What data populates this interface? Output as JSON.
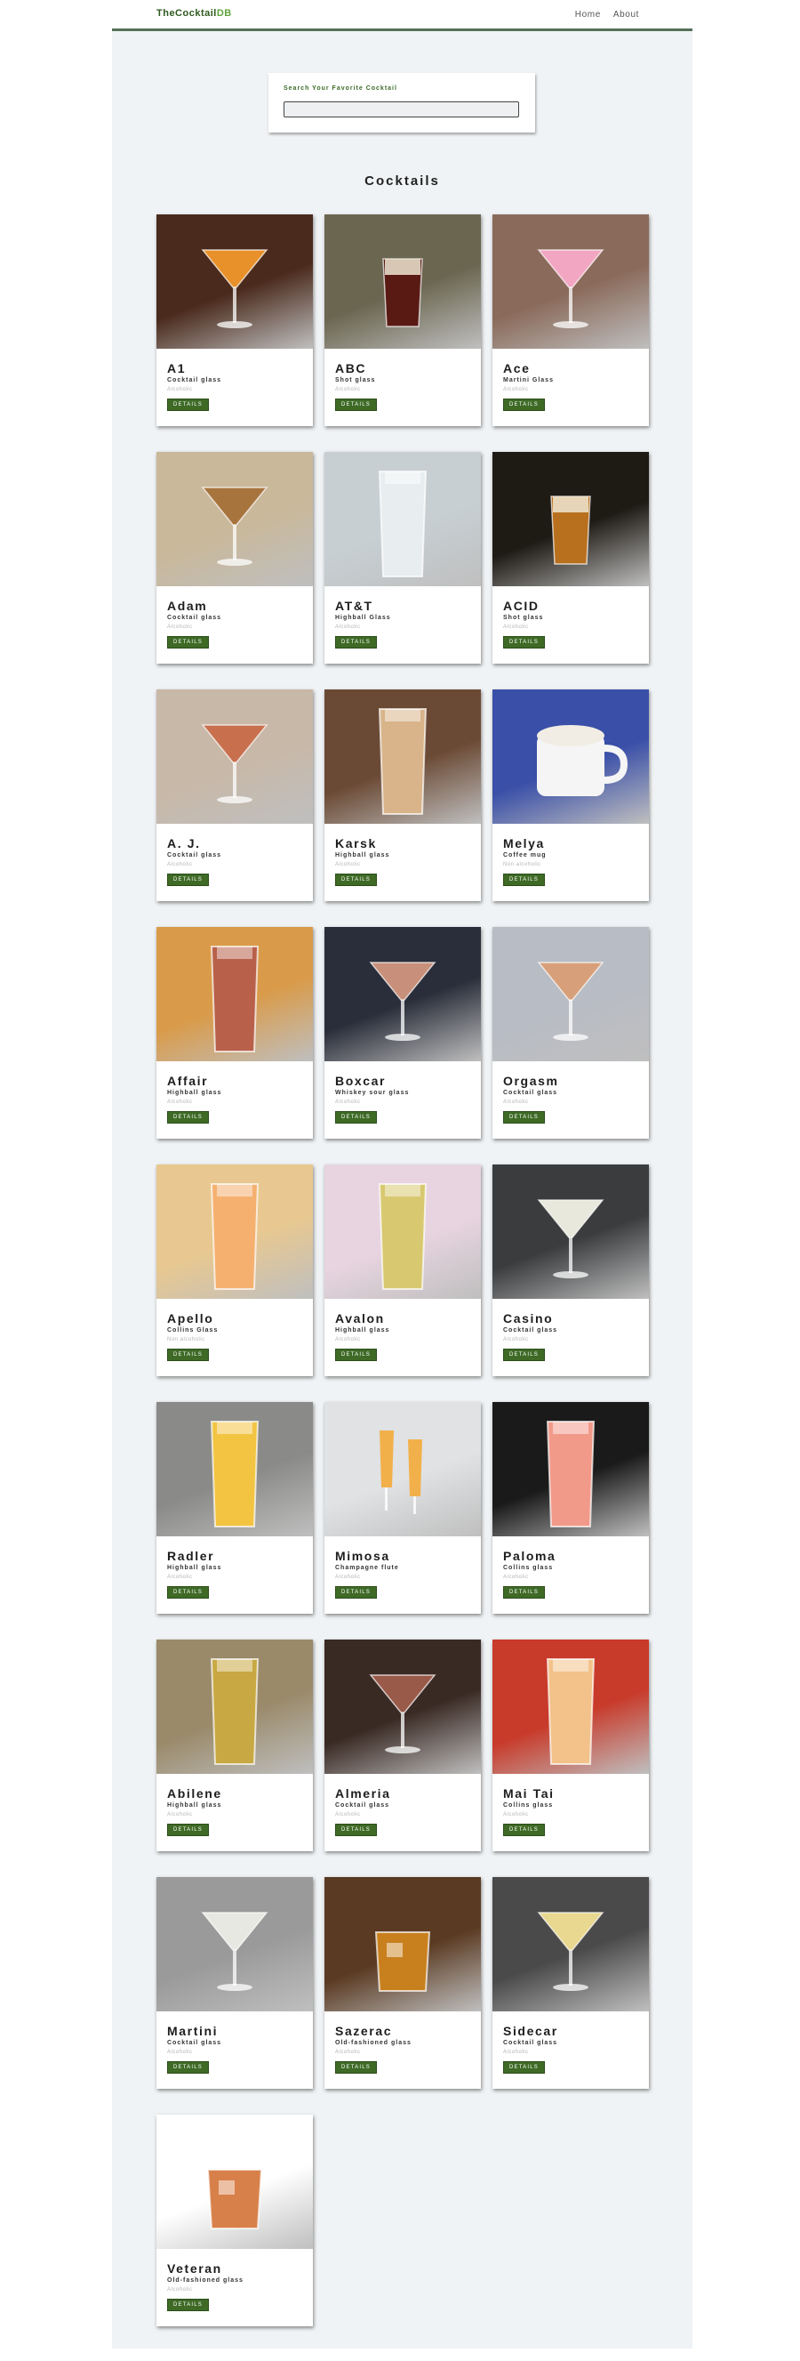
{
  "brand": {
    "part1": "TheCocktail",
    "part2": "DB"
  },
  "nav": {
    "home": "Home",
    "about": "About"
  },
  "search": {
    "label": "Search Your Favorite Cocktail",
    "value": "",
    "placeholder": ""
  },
  "section_title": "Cocktails",
  "details_label": "DETAILS",
  "cocktails": [
    {
      "name": "A1",
      "glass": "Cocktail glass",
      "alcoholic": "Alcoholic",
      "bg": "#4a2a1c",
      "drink": "#e8902a"
    },
    {
      "name": "ABC",
      "glass": "Shot glass",
      "alcoholic": "Alcoholic",
      "bg": "#6b6650",
      "drink": "#5a1a14"
    },
    {
      "name": "Ace",
      "glass": "Martini Glass",
      "alcoholic": "Alcoholic",
      "bg": "#8a6a5a",
      "drink": "#f2a6c2"
    },
    {
      "name": "Adam",
      "glass": "Cocktail glass",
      "alcoholic": "Alcoholic",
      "bg": "#c9b89a",
      "drink": "#a8743e"
    },
    {
      "name": "AT&T",
      "glass": "Highball Glass",
      "alcoholic": "Alcoholic",
      "bg": "#c7cfd3",
      "drink": "#e8eef0"
    },
    {
      "name": "ACID",
      "glass": "Shot glass",
      "alcoholic": "Alcoholic",
      "bg": "#1e1a14",
      "drink": "#b8701f"
    },
    {
      "name": "A. J.",
      "glass": "Cocktail glass",
      "alcoholic": "Alcoholic",
      "bg": "#c8b8a8",
      "drink": "#c8704e"
    },
    {
      "name": "Karsk",
      "glass": "Highball glass",
      "alcoholic": "Alcoholic",
      "bg": "#6b4a35",
      "drink": "#d9b48a"
    },
    {
      "name": "Melya",
      "glass": "Coffee mug",
      "alcoholic": "Non alcoholic",
      "bg": "#3a4fa8",
      "drink": "#f2ede4"
    },
    {
      "name": "Affair",
      "glass": "Highball glass",
      "alcoholic": "Alcoholic",
      "bg": "#d99b4a",
      "drink": "#b8604a"
    },
    {
      "name": "Boxcar",
      "glass": "Whiskey sour glass",
      "alcoholic": "Alcoholic",
      "bg": "#2a2e3a",
      "drink": "#c8907a"
    },
    {
      "name": "Orgasm",
      "glass": "Cocktail glass",
      "alcoholic": "Alcoholic",
      "bg": "#b8bcc4",
      "drink": "#d8a07a"
    },
    {
      "name": "Apello",
      "glass": "Collins Glass",
      "alcoholic": "Non alcoholic",
      "bg": "#e8c890",
      "drink": "#f5b070"
    },
    {
      "name": "Avalon",
      "glass": "Highball glass",
      "alcoholic": "Alcoholic",
      "bg": "#e8d4e0",
      "drink": "#d8c870"
    },
    {
      "name": "Casino",
      "glass": "Cocktail glass",
      "alcoholic": "Alcoholic",
      "bg": "#3a3c3e",
      "drink": "#e8e8dc"
    },
    {
      "name": "Radler",
      "glass": "Highball glass",
      "alcoholic": "Alcoholic",
      "bg": "#8a8a88",
      "drink": "#f2c442"
    },
    {
      "name": "Mimosa",
      "glass": "Champagne flute",
      "alcoholic": "Alcoholic",
      "bg": "#e0e2e4",
      "drink": "#f2b04a"
    },
    {
      "name": "Paloma",
      "glass": "Collins glass",
      "alcoholic": "Alcoholic",
      "bg": "#1a1a1a",
      "drink": "#f29a8a"
    },
    {
      "name": "Abilene",
      "glass": "Highball glass",
      "alcoholic": "Alcoholic",
      "bg": "#9a8a6a",
      "drink": "#c8a842"
    },
    {
      "name": "Almeria",
      "glass": "Cocktail glass",
      "alcoholic": "Alcoholic",
      "bg": "#3a2a24",
      "drink": "#9a5a4a"
    },
    {
      "name": "Mai Tai",
      "glass": "Collins glass",
      "alcoholic": "Alcoholic",
      "bg": "#c83a2a",
      "drink": "#f2c28a"
    },
    {
      "name": "Martini",
      "glass": "Cocktail glass",
      "alcoholic": "Alcoholic",
      "bg": "#9a9a9a",
      "drink": "#e8e8e2"
    },
    {
      "name": "Sazerac",
      "glass": "Old-fashioned glass",
      "alcoholic": "Alcoholic",
      "bg": "#5a3a22",
      "drink": "#c8801e"
    },
    {
      "name": "Sidecar",
      "glass": "Cocktail glass",
      "alcoholic": "Alcoholic",
      "bg": "#4a4a4a",
      "drink": "#e8d890"
    },
    {
      "name": "Veteran",
      "glass": "Old-fashioned glass",
      "alcoholic": "Alcoholic",
      "bg": "#ffffff",
      "drink": "#d8804a"
    }
  ]
}
